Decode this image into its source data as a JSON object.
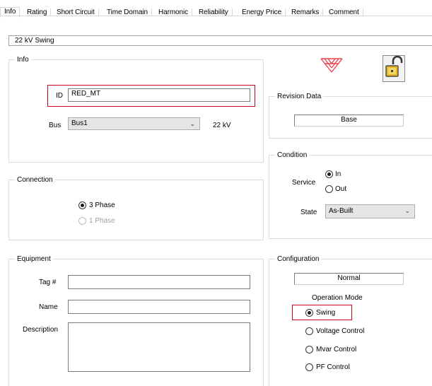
{
  "tabs": [
    {
      "label": "Info",
      "active": true
    },
    {
      "label": "Rating"
    },
    {
      "label": "Short Circuit"
    },
    {
      "label": "Time Domain"
    },
    {
      "label": "Harmonic"
    },
    {
      "label": "Reliability"
    },
    {
      "label": "Energy Price"
    },
    {
      "label": "Remarks"
    },
    {
      "label": "Comment"
    }
  ],
  "header": {
    "title": "22 kV  Swing"
  },
  "info": {
    "legend": "Info",
    "id_label": "ID",
    "id_value": "RED_MT",
    "bus_label": "Bus",
    "bus_value": "Bus1",
    "bus_voltage": "22 kV"
  },
  "connection": {
    "legend": "Connection",
    "option_3phase": "3 Phase",
    "option_1phase": "1 Phase",
    "selected": "3 Phase"
  },
  "equipment": {
    "legend": "Equipment",
    "tag_label": "Tag #",
    "tag_value": "",
    "name_label": "Name",
    "name_value": "",
    "description_label": "Description",
    "description_value": ""
  },
  "revision": {
    "legend": "Revision Data",
    "value": "Base"
  },
  "condition": {
    "legend": "Condition",
    "service_label": "Service",
    "service_in": "In",
    "service_out": "Out",
    "service_selected": "In",
    "state_label": "State",
    "state_value": "As-Built"
  },
  "configuration": {
    "legend": "Configuration",
    "value": "Normal",
    "operation_mode_label": "Operation Mode",
    "modes": [
      "Swing",
      "Voltage Control",
      "Mvar Control",
      "PF Control"
    ],
    "selected_mode": "Swing"
  },
  "icons": {
    "generator": "generator-symbol-icon",
    "lock": "unlocked-padlock-icon"
  },
  "colors": {
    "highlight": "#d0021b",
    "generator_symbol": "#e8434f"
  }
}
